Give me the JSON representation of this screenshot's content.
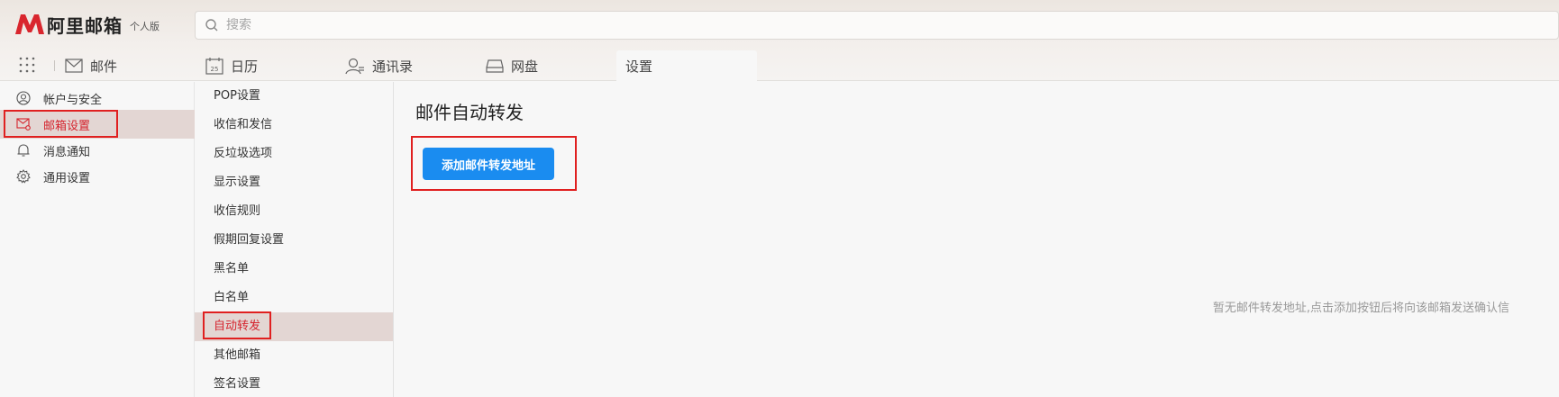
{
  "header": {
    "logo_text": "阿里邮箱",
    "logo_sub": "个人版",
    "search_placeholder": "搜索"
  },
  "nav": {
    "tabs": [
      {
        "label": "邮件",
        "icon": "mail-icon"
      },
      {
        "label": "日历",
        "icon": "calendar-icon",
        "icon_text": "25"
      },
      {
        "label": "通讯录",
        "icon": "contacts-icon"
      },
      {
        "label": "网盘",
        "icon": "drive-icon"
      },
      {
        "label": "设置",
        "active": true
      }
    ]
  },
  "sidebar": {
    "items": [
      {
        "label": "帐户与安全",
        "icon": "user-icon"
      },
      {
        "label": "邮箱设置",
        "icon": "mail-settings-icon",
        "active": true
      },
      {
        "label": "消息通知",
        "icon": "bell-icon"
      },
      {
        "label": "通用设置",
        "icon": "gear-icon"
      }
    ]
  },
  "submenu": {
    "items": [
      {
        "label": "POP设置"
      },
      {
        "label": "收信和发信"
      },
      {
        "label": "反垃圾选项"
      },
      {
        "label": "显示设置"
      },
      {
        "label": "收信规则"
      },
      {
        "label": "假期回复设置"
      },
      {
        "label": "黑名单"
      },
      {
        "label": "白名单"
      },
      {
        "label": "自动转发",
        "active": true
      },
      {
        "label": "其他邮箱"
      },
      {
        "label": "签名设置"
      }
    ]
  },
  "main": {
    "title": "邮件自动转发",
    "add_button": "添加邮件转发地址",
    "empty_hint": "暂无邮件转发地址,点击添加按钮后将向该邮箱发送确认信"
  },
  "colors": {
    "accent_red": "#d5232d",
    "button_blue": "#1a8cf0",
    "active_bg": "#e3d6d3",
    "highlight_box": "#e02020"
  }
}
